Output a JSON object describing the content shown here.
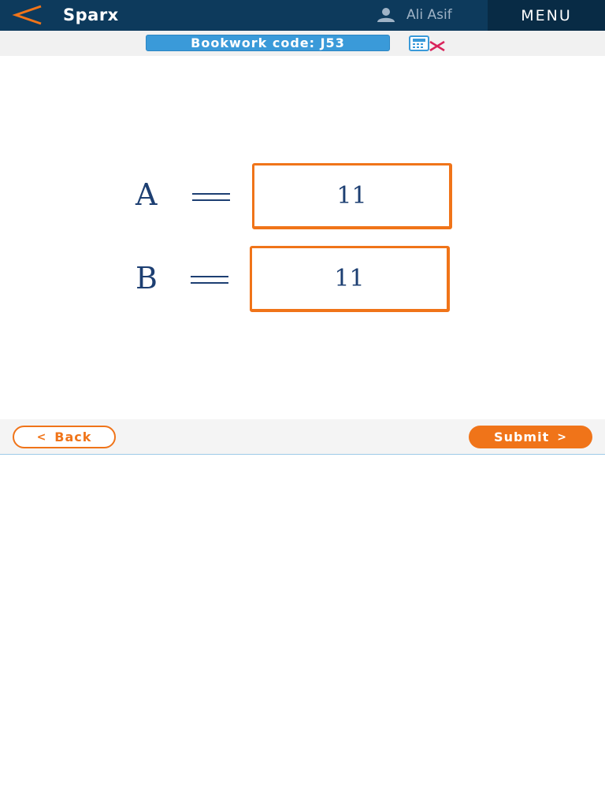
{
  "header": {
    "brand": "Sparx",
    "user_name": "Ali Asif",
    "menu_label": "MENU"
  },
  "bookwork": {
    "label": "Bookwork code: J53"
  },
  "answers": [
    {
      "label": "A",
      "value": "11"
    },
    {
      "label": "B",
      "value": "11"
    }
  ],
  "nav": {
    "back_label": "Back",
    "submit_label": "Submit"
  },
  "icons": {
    "back": "back-chevron-icon",
    "user": "user-icon",
    "calculator": "calculator-not-allowed-icon",
    "back_button": "chevron-left-icon",
    "submit_button": "chevron-right-icon"
  },
  "colors": {
    "header_bg": "#0d3a5c",
    "menu_bg": "#082b45",
    "accent_orange": "#f07419",
    "bookwork_blue": "#3a9ad9",
    "text_navy": "#1d3f72"
  }
}
